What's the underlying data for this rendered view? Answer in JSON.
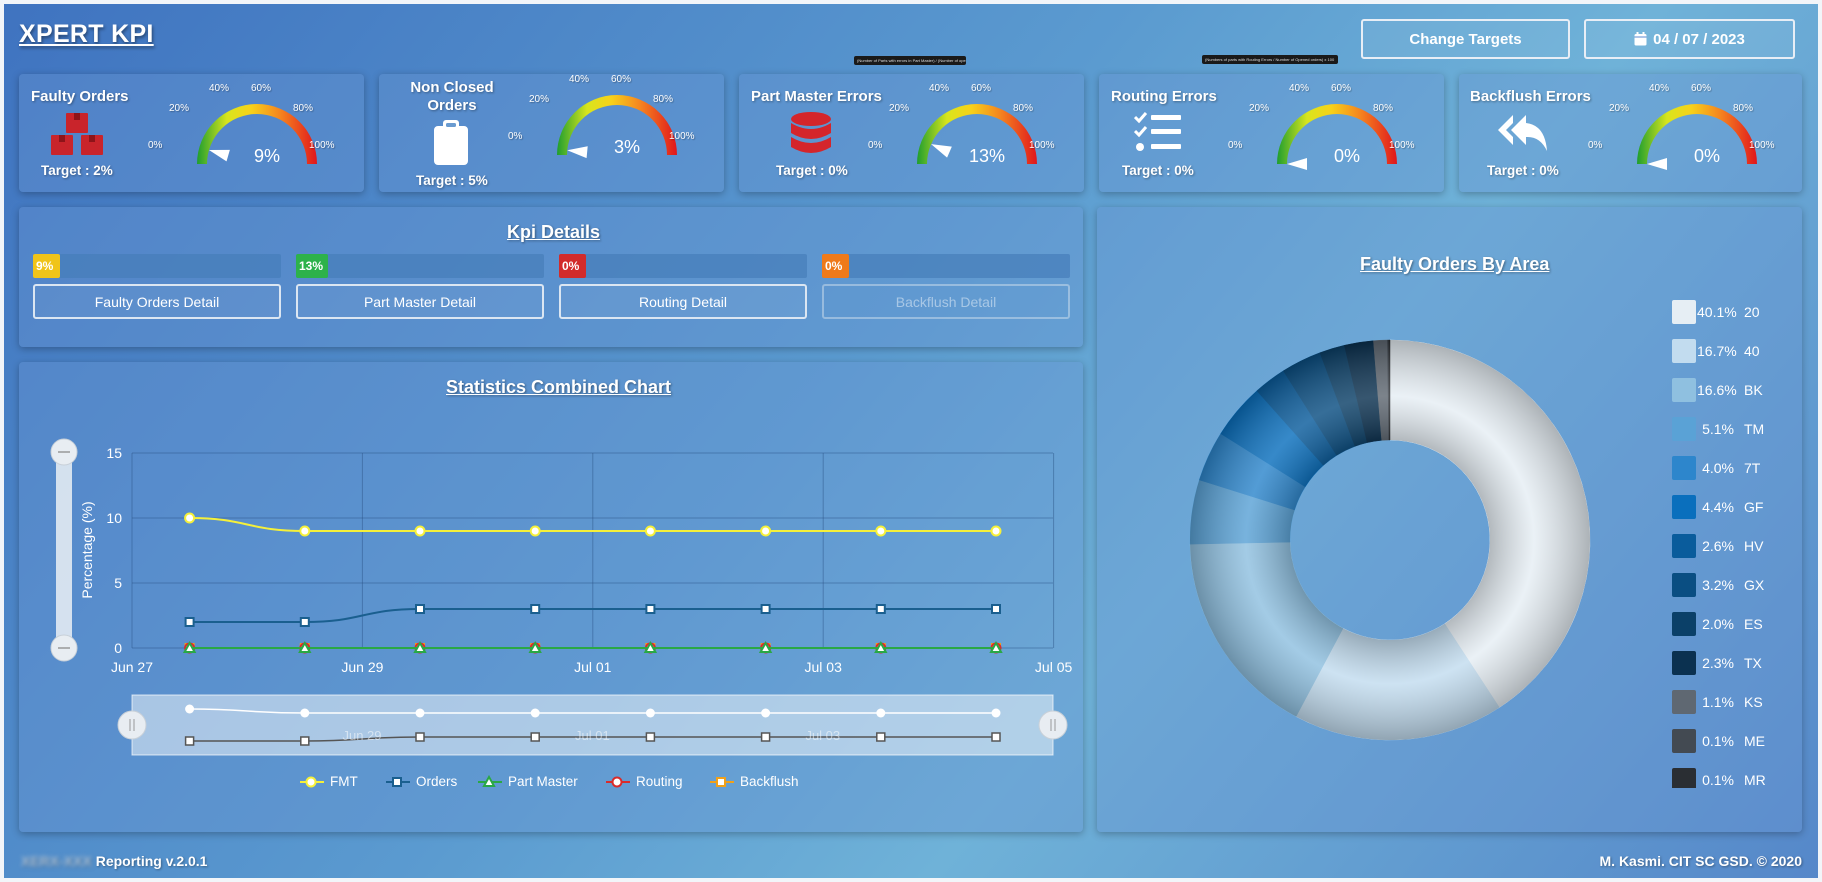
{
  "app": {
    "title": "XPERT KPI"
  },
  "header": {
    "change_targets": "Change Targets",
    "date": "04 / 07 / 2023"
  },
  "gauge_ticks": [
    "0%",
    "20%",
    "40%",
    "60%",
    "80%",
    "100%"
  ],
  "kpis": [
    {
      "title": "Faulty Orders",
      "target": "Target : 2%",
      "value": "9%",
      "percent": 9,
      "icon": "boxes-icon"
    },
    {
      "title": "Non Closed Orders",
      "target": "Target : 5%",
      "value": "3%",
      "percent": 3,
      "icon": "clipboard-icon"
    },
    {
      "title": "Part Master Errors",
      "target": "Target : 0%",
      "value": "13%",
      "percent": 13,
      "icon": "database-icon"
    },
    {
      "title": "Routing Errors",
      "target": "Target : 0%",
      "value": "0%",
      "percent": 0,
      "icon": "checklist-icon"
    },
    {
      "title": "Backflush Errors",
      "target": "Target : 0%",
      "value": "0%",
      "percent": 0,
      "icon": "reply-all-icon"
    }
  ],
  "tooltips": [
    "(Number of Parts with errors in Part Master) / (Number of opened orders) x 100",
    "(Numbers of parts with Routing Errors / Number of Opened orders) x 100"
  ],
  "kpi_details": {
    "title": "Kpi Details",
    "items": [
      {
        "percent_label": "9%",
        "fill": 0.09,
        "color": "#f0c419",
        "button": "Faulty Orders Detail",
        "enabled": true
      },
      {
        "percent_label": "13%",
        "fill": 0.13,
        "color": "#2db24a",
        "button": "Part Master Detail",
        "enabled": true
      },
      {
        "percent_label": "0%",
        "fill": 0,
        "color": "#d22b2b",
        "button": "Routing Detail",
        "enabled": true
      },
      {
        "percent_label": "0%",
        "fill": 0,
        "color": "#ef7a1a",
        "button": "Backflush Detail",
        "enabled": false
      }
    ]
  },
  "stats": {
    "title": "Statistics Combined Chart"
  },
  "chart_data": [
    {
      "type": "line",
      "title": "Statistics Combined Chart",
      "xlabel": "",
      "ylabel": "Percentage (%)",
      "x_ticks": [
        "Jun 27",
        "Jun 29",
        "Jul 01",
        "Jul 03",
        "Jul 05"
      ],
      "x": [
        "Jun 27 12:00",
        "Jun 28 12:00",
        "Jun 29 12:00",
        "Jun 30 12:00",
        "Jul 01 12:00",
        "Jul 02 12:00",
        "Jul 03 12:00",
        "Jul 04 12:00"
      ],
      "ylim": [
        0,
        15
      ],
      "y_ticks": [
        0,
        5,
        10,
        15
      ],
      "grid": true,
      "legend_position": "bottom",
      "navigator_ticks": [
        "Jun 29",
        "Jul 01",
        "Jul 03"
      ],
      "series": [
        {
          "name": "FMT",
          "color": "#f5f03a",
          "marker": "circle",
          "values": [
            10,
            9,
            9,
            9,
            9,
            9,
            9,
            9
          ]
        },
        {
          "name": "Orders",
          "color": "#1a5f8f",
          "marker": "square",
          "values": [
            2,
            2,
            3,
            3,
            3,
            3,
            3,
            3
          ]
        },
        {
          "name": "Part Master",
          "color": "#2aa845",
          "marker": "triangle",
          "values": [
            0,
            0,
            0,
            0,
            0,
            0,
            0,
            0
          ]
        },
        {
          "name": "Routing",
          "color": "#d92b2b",
          "marker": "circle",
          "values": [
            0,
            0,
            0,
            0,
            0,
            0,
            0,
            0
          ]
        },
        {
          "name": "Backflush",
          "color": "#f0a11a",
          "marker": "square",
          "values": [
            0,
            0,
            0,
            0,
            0,
            0,
            0,
            0
          ]
        }
      ]
    },
    {
      "type": "pie",
      "title": "Faulty Orders By Area",
      "legend_position": "right",
      "categories": [
        "20",
        "40",
        "BK",
        "TM",
        "7T",
        "GF",
        "HV",
        "GX",
        "ES",
        "TX",
        "KS",
        "ME",
        "MR"
      ],
      "labels": [
        "40.1%",
        "16.7%",
        "16.6%",
        "5.1%",
        "4.0%",
        "4.4%",
        "2.6%",
        "3.2%",
        "2.0%",
        "2.3%",
        "1.1%",
        "0.1%",
        "0.1%"
      ],
      "values": [
        40.1,
        16.7,
        16.6,
        5.1,
        4.0,
        4.4,
        2.6,
        3.2,
        2.0,
        2.3,
        1.1,
        0.1,
        0.1
      ],
      "colors": [
        "#e6eef4",
        "#c2dcef",
        "#8fc0e0",
        "#5aa2d6",
        "#2d86cc",
        "#0a6fbd",
        "#0a5c9c",
        "#0a4e82",
        "#0b4068",
        "#0b3150",
        "#5f6872",
        "#434a52",
        "#2a2e33"
      ]
    }
  ],
  "footer": {
    "left_blurred": "XERX-XXX",
    "left": "Reporting v.2.0.1",
    "right": "M. Kasmi. CIT SC GSD. © 2020"
  }
}
